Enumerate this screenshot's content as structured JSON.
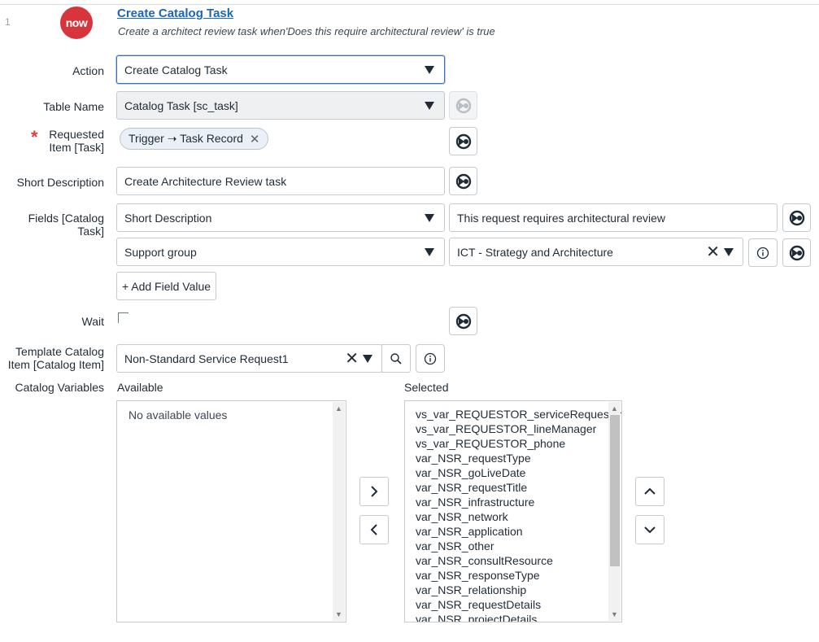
{
  "step": {
    "number": "1",
    "logo_text": "now",
    "title": "Create Catalog Task",
    "subtitle": "Create a architect review task when'Does this require architectural review' is true"
  },
  "form": {
    "action": {
      "label": "Action",
      "value": "Create Catalog Task"
    },
    "table_name": {
      "label": "Table Name",
      "value": "Catalog Task [sc_task]"
    },
    "requested_item": {
      "label_line1": "Requested",
      "label_line2": "Item [Task]",
      "token": "Trigger ➝ Task Record",
      "required_mark": "*"
    },
    "short_description": {
      "label": "Short Description",
      "value": "Create Architecture Review task"
    },
    "fields": {
      "label": "Fields [Catalog Task]",
      "rows": [
        {
          "field": "Short Description",
          "value": "This request requires architectural review"
        },
        {
          "field": "Support group",
          "value": "ICT - Strategy and Architecture"
        }
      ],
      "add_button": "+ Add Field Value"
    },
    "wait": {
      "label": "Wait"
    },
    "template_item": {
      "label_line1": "Template Catalog",
      "label_line2": "Item [Catalog Item]",
      "value": "Non-Standard Service Request1"
    },
    "catalog_variables": {
      "label": "Catalog Variables",
      "available_label": "Available",
      "selected_label": "Selected",
      "available_empty": "No available values",
      "selected": [
        "vs_var_REQUESTOR_serviceRequestor",
        "vs_var_REQUESTOR_lineManager",
        "vs_var_REQUESTOR_phone",
        "var_NSR_requestType",
        "var_NSR_goLiveDate",
        "var_NSR_requestTitle",
        "var_NSR_infrastructure",
        "var_NSR_network",
        "var_NSR_application",
        "var_NSR_other",
        "var_NSR_consultResource",
        "var_NSR_responseType",
        "var_NSR_relationship",
        "var_NSR_requestDetails",
        "var_NSR_projectDetails"
      ]
    }
  },
  "colors": {
    "accent": "#1a67b9",
    "logo": "#d8343c",
    "required": "#e0403a"
  }
}
